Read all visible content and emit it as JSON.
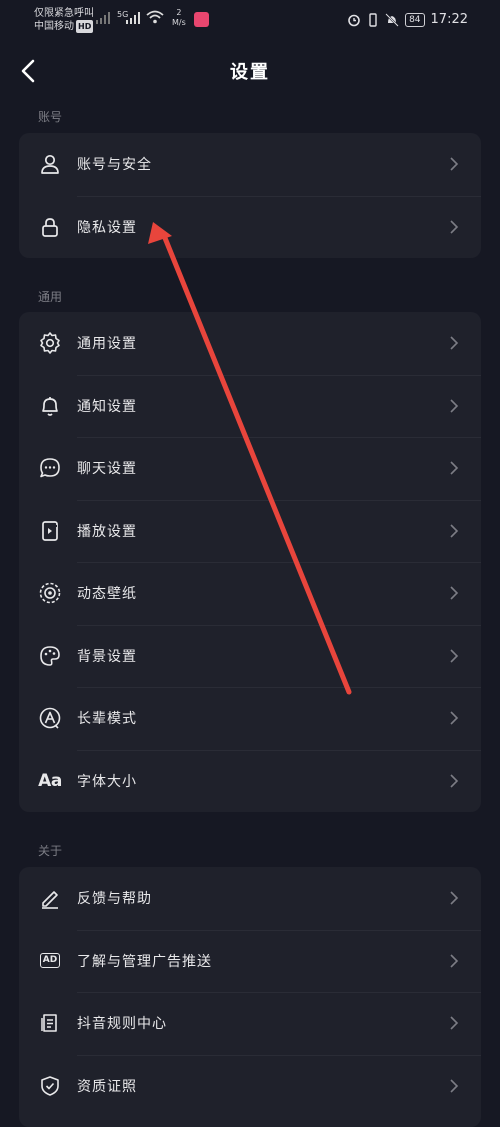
{
  "status_bar": {
    "line1": "仅限紧急呼叫",
    "line2": "中国移动",
    "hd": "HD",
    "net": "5G",
    "speed_value": "2",
    "speed_unit": "M/s",
    "battery": "84",
    "time": "17:22"
  },
  "header": {
    "title": "设置"
  },
  "sections": [
    {
      "title": "账号",
      "items": [
        {
          "label": "账号与安全",
          "icon": "person-icon"
        },
        {
          "label": "隐私设置",
          "icon": "lock-icon"
        }
      ]
    },
    {
      "title": "通用",
      "items": [
        {
          "label": "通用设置",
          "icon": "gear-icon"
        },
        {
          "label": "通知设置",
          "icon": "bell-icon"
        },
        {
          "label": "聊天设置",
          "icon": "chat-bubble-icon"
        },
        {
          "label": "播放设置",
          "icon": "play-settings-icon"
        },
        {
          "label": "动态壁纸",
          "icon": "live-wallpaper-icon"
        },
        {
          "label": "背景设置",
          "icon": "palette-icon"
        },
        {
          "label": "长辈模式",
          "icon": "elder-mode-icon"
        },
        {
          "label": "字体大小",
          "icon": "font-size-icon",
          "glyph": "Aa"
        }
      ]
    },
    {
      "title": "关于",
      "items": [
        {
          "label": "反馈与帮助",
          "icon": "pencil-icon"
        },
        {
          "label": "了解与管理广告推送",
          "icon": "ad-icon",
          "glyph": "AD"
        },
        {
          "label": "抖音规则中心",
          "icon": "document-icon"
        },
        {
          "label": "资质证照",
          "icon": "shield-check-icon"
        }
      ]
    }
  ],
  "annotation": {
    "color": "#e8453c"
  }
}
